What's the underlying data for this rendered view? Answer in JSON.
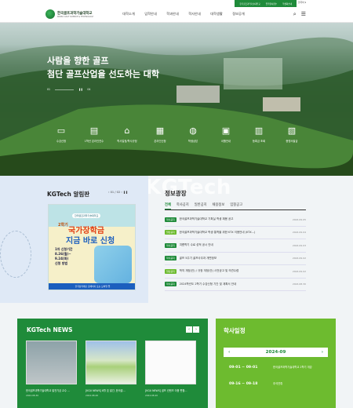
{
  "topbar": {
    "util_links": [
      "한국골프과학기술대학교",
      "입학원서접수",
      "학생회안내"
    ],
    "lang": "한국어 ▾"
  },
  "header": {
    "logo_kor": "한국골프과학기술대학교",
    "logo_eng": "KOREA GOLF SCIENCE & TECHNOLOGY",
    "nav": [
      "대학소개",
      "입학안내",
      "학과안내",
      "학사안내",
      "대학생활",
      "정보공개"
    ],
    "search_icon": "search-icon",
    "menu_icon": "hamburger-icon"
  },
  "hero": {
    "headline_1": "사람을 향한 골프",
    "headline_2": "첨단 골프산업을 선도하는 대학",
    "pager_current": "01",
    "pager_total": "04",
    "quick_links": [
      {
        "label": "수강신청",
        "icon": "monitor-icon"
      },
      {
        "label": "1학년 온라인연수",
        "icon": "book-icon"
      },
      {
        "label": "학사일정/학사규정",
        "icon": "graduation-cap-icon"
      },
      {
        "label": "온라인신청",
        "icon": "clipboard-icon"
      },
      {
        "label": "학생상담",
        "icon": "chat-icon"
      },
      {
        "label": "셔틀안내",
        "icon": "bus-icon"
      },
      {
        "label": "등록금 조회",
        "icon": "calculator-icon"
      },
      {
        "label": "증명서발급",
        "icon": "certificate-icon"
      }
    ]
  },
  "watermark": "KGTech",
  "notice": {
    "title": "KGTech 알림판",
    "counter": "01 / 02",
    "banner": {
      "caption": "한국골프과학기술대학교",
      "year": "2학기",
      "big_1": "국가장학금",
      "big_2": "지금 바로 신청",
      "left_text": "1차 신청기간\n8.26(월)~\n9.24(화)\n신청 방법",
      "footer": "한국장학재단 홈페이지 또는 모바일 앱"
    }
  },
  "info": {
    "title": "정보광장",
    "tabs": [
      "전체",
      "학사공지",
      "일반공지",
      "채용정보",
      "입찰공고"
    ],
    "items": [
      {
        "tag": "학사공지",
        "title": "한국골프과학기술대학교 기획실 학생 채용 공고",
        "date": "2024.09.05",
        "alt": false
      },
      {
        "tag": "일반공지",
        "title": "한국골프과학기술대학교 학생 통학을 위한 KTX 이용안내 (KTX...)",
        "date": "2024.09.04",
        "alt": true
      },
      {
        "tag": "학사공지",
        "title": "여름학기 수료 성적 공시 안내",
        "date": "2024.09.03",
        "alt": false
      },
      {
        "tag": "학사공지",
        "title": "골프 5주기 골프사무과 개편정보",
        "date": "2024.09.02",
        "alt": false
      },
      {
        "tag": "일반공지",
        "title": "학칙 개정(안) / 규정 개정(안) 사전공고 및 의견수렴",
        "date": "2024.09.02",
        "alt": true
      },
      {
        "tag": "학사공지",
        "title": "2024학년도 2학기 수강신청 기간 및 계획서 안내",
        "date": "2024.08.30",
        "alt": false
      }
    ]
  },
  "news": {
    "title": "KGTech NEWS",
    "prev": "‹",
    "next": "›",
    "cards": [
      {
        "caption": "한국골프과학기술대학교 발전기금 교수 ...",
        "date": "2024.08.30"
      },
      {
        "caption": "[KGU NEWS] 8월 호 발간, 한국골...",
        "date": "2024.08.26"
      },
      {
        "caption": "[KGU NEWS] 골프 컨텐츠 이용 편합...",
        "date": "2024.08.20"
      }
    ]
  },
  "schedule": {
    "title": "학사일정",
    "month": "2024-09",
    "prev": "‹",
    "next": "›",
    "events": [
      {
        "date": "09-01 ~ 09-01",
        "text": "한국골프과학기술대학교 2학기 개강"
      },
      {
        "date": "09-16 ~ 09-18",
        "text": "추석연휴"
      }
    ]
  },
  "colors": {
    "primary_green": "#1f8b3a",
    "light_green": "#6dbb2f",
    "notice_bg": "#dfe9f6"
  }
}
